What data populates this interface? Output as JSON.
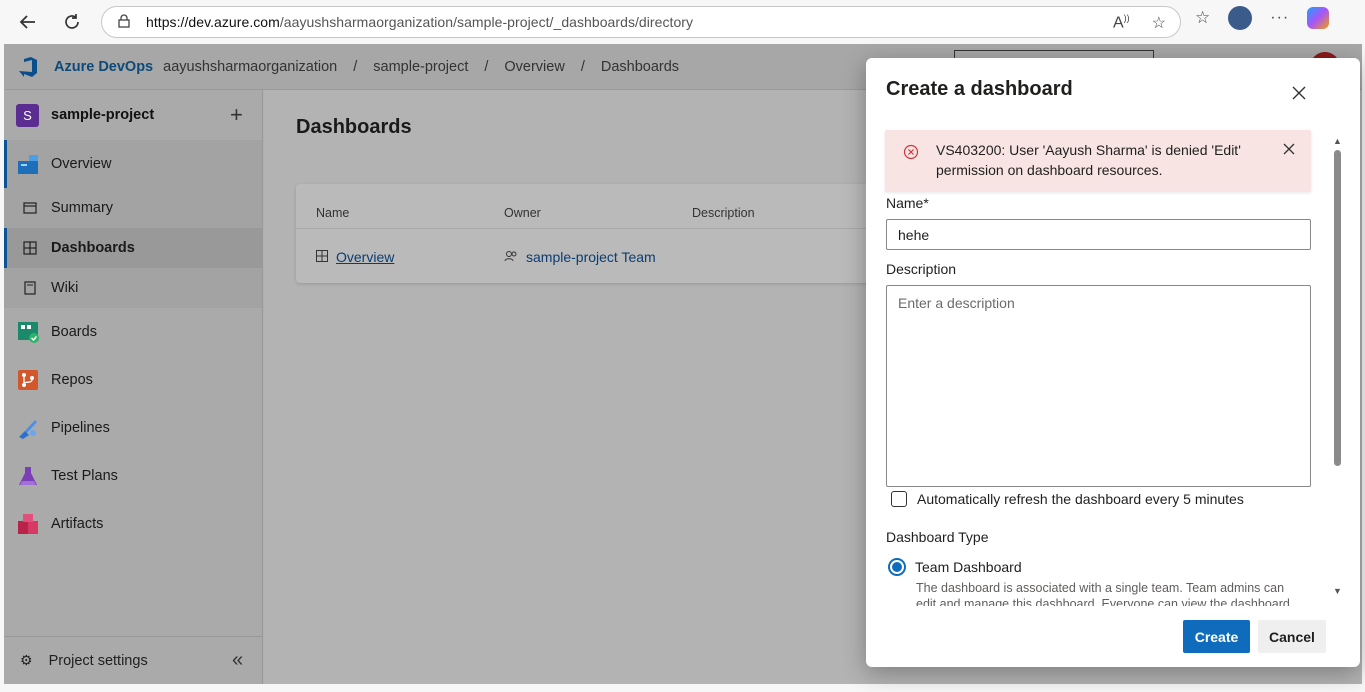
{
  "browser": {
    "url_host": "https://dev.azure.com",
    "url_path": "/aayushsharmaorganization/sample-project/_dashboards/directory"
  },
  "topbar": {
    "app_title": "Azure DevOps",
    "breadcrumbs": [
      "aayushsharmaorganization",
      "sample-project",
      "Overview",
      "Dashboards"
    ]
  },
  "sidebar": {
    "project_initial": "S",
    "project_name": "sample-project",
    "items": [
      {
        "label": "Overview",
        "icon": "overview-icon"
      },
      {
        "label": "Summary",
        "icon": "summary-icon"
      },
      {
        "label": "Dashboards",
        "icon": "dashboards-icon"
      },
      {
        "label": "Wiki",
        "icon": "wiki-icon"
      },
      {
        "label": "Boards",
        "icon": "boards-icon"
      },
      {
        "label": "Repos",
        "icon": "repos-icon"
      },
      {
        "label": "Pipelines",
        "icon": "pipelines-icon"
      },
      {
        "label": "Test Plans",
        "icon": "test-plans-icon"
      },
      {
        "label": "Artifacts",
        "icon": "artifacts-icon"
      }
    ],
    "footer_label": "Project settings",
    "collapse_glyph": "«"
  },
  "main": {
    "title": "Dashboards",
    "columns": [
      "Name",
      "Owner",
      "Description"
    ],
    "rows": [
      {
        "name": "Overview",
        "owner": "sample-project Team",
        "description": ""
      }
    ]
  },
  "dialog": {
    "title": "Create a dashboard",
    "error": "VS403200: User 'Aayush Sharma' is denied 'Edit' permission on dashboard resources.",
    "name_label": "Name*",
    "name_value": "hehe",
    "description_label": "Description",
    "description_placeholder": "Enter a description",
    "auto_refresh_label": "Automatically refresh the dashboard every 5 minutes",
    "auto_refresh_checked": false,
    "type_label": "Dashboard Type",
    "type_option": "Team Dashboard",
    "type_option_desc": "The dashboard is associated with a single team. Team admins can edit and manage this dashboard. Everyone can view the dashboard.",
    "create_label": "Create",
    "cancel_label": "Cancel"
  },
  "colors": {
    "accent": "#0f6cbd",
    "error_bg": "#f8e5e3",
    "error_icon": "#d13438",
    "project_badge": "#5c2d91"
  }
}
